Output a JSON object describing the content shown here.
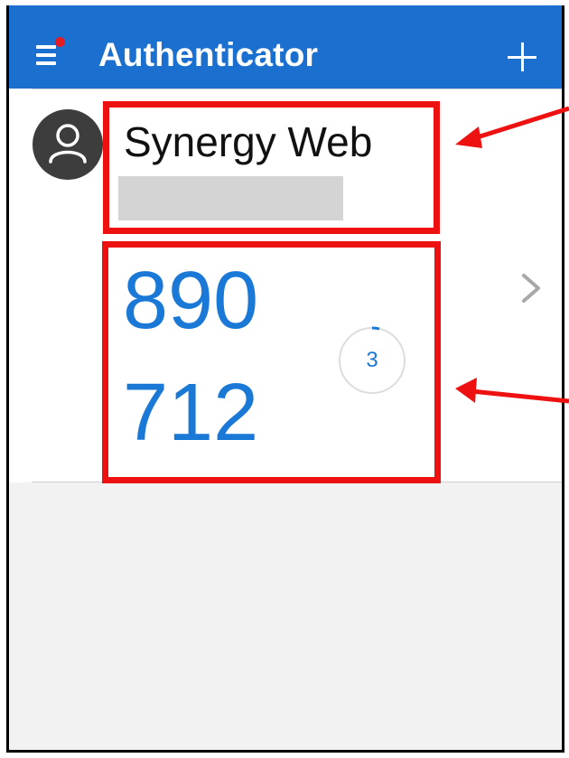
{
  "header": {
    "title": "Authenticator",
    "menu_icon": "hamburger-menu-icon",
    "add_icon": "plus-icon"
  },
  "account": {
    "name": "Synergy Web",
    "username": "",
    "avatar_icon": "person-icon",
    "code_part1": "890",
    "code_part2": "712",
    "seconds_remaining": "3",
    "chevron_icon": "chevron-right-icon"
  },
  "colors": {
    "header_bg": "#1a6fcf",
    "code_text": "#1a78d6",
    "notification_dot": "#e31b23",
    "annotation": "#ee1111"
  }
}
